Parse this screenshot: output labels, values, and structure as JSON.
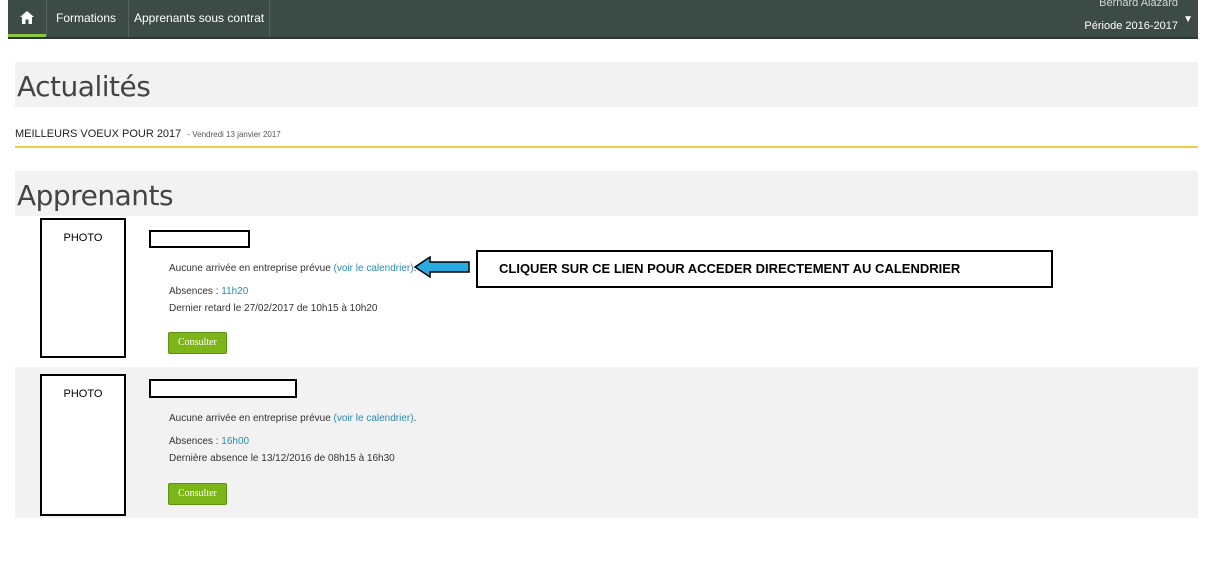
{
  "nav": {
    "items": [
      "Formations",
      "Apprenants sous contrat"
    ],
    "user_name": "Bernard Alazard",
    "period": "Période 2016-2017"
  },
  "news_section": {
    "title": "Actualités",
    "item_title": "MEILLEURS VOEUX POUR 2017",
    "item_date": "- Vendredi 13 janvier 2017"
  },
  "learners_section": {
    "title": "Apprenants",
    "cards": [
      {
        "photo_label": "PHOTO",
        "arrival_text": "Aucune arrivée en entreprise prévue",
        "calendar_link": "(voir le calendrier)",
        "absences_label": "Absences :",
        "absences_value": "11h20",
        "last_event": "Dernier retard le 27/02/2017 de 10h15 à 10h20",
        "button_label": "Consulter"
      },
      {
        "photo_label": "PHOTO",
        "arrival_text": "Aucune arrivée en entreprise prévue",
        "calendar_link": "(voir le calendrier)",
        "absences_label": "Absences :",
        "absences_value": "16h00",
        "last_event": "Dernière absence le 13/12/2016 de 08h15 à 16h30",
        "button_label": "Consulter"
      }
    ]
  },
  "annotation": {
    "callout_text": "CLIQUER SUR CE LIEN POUR ACCEDER DIRECTEMENT AU CALENDRIER",
    "arrow_color": "#29abe2"
  },
  "colors": {
    "nav_bg": "#3d4b47",
    "accent_green": "#7cb518",
    "link_blue": "#2a8bb5",
    "news_underline": "#f3c948"
  }
}
